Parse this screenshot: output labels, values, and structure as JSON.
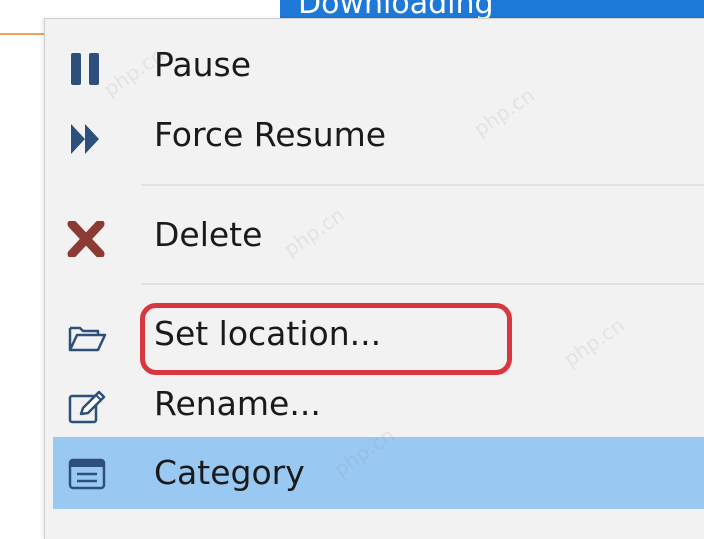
{
  "background": {
    "highlighted_text": "Downloading"
  },
  "menu": {
    "items": [
      {
        "label": "Pause",
        "icon": "pause-icon"
      },
      {
        "label": "Force Resume",
        "icon": "force-resume-icon"
      },
      {
        "label": "Delete",
        "icon": "delete-icon"
      },
      {
        "label": "Set location...",
        "icon": "folder-icon"
      },
      {
        "label": "Rename...",
        "icon": "rename-icon"
      },
      {
        "label": "Category",
        "icon": "category-icon"
      }
    ],
    "selected_item": "Category"
  },
  "annotation": {
    "color": "#d9373f",
    "target": "Set location..."
  },
  "watermark": "php.cn",
  "colors": {
    "menu_background": "#f2f2f2",
    "selected_background": "#99c9f2",
    "icon_blue": "#2d4f7c",
    "delete_red": "#8c3a34",
    "title_bar_blue": "#1e78d7"
  }
}
